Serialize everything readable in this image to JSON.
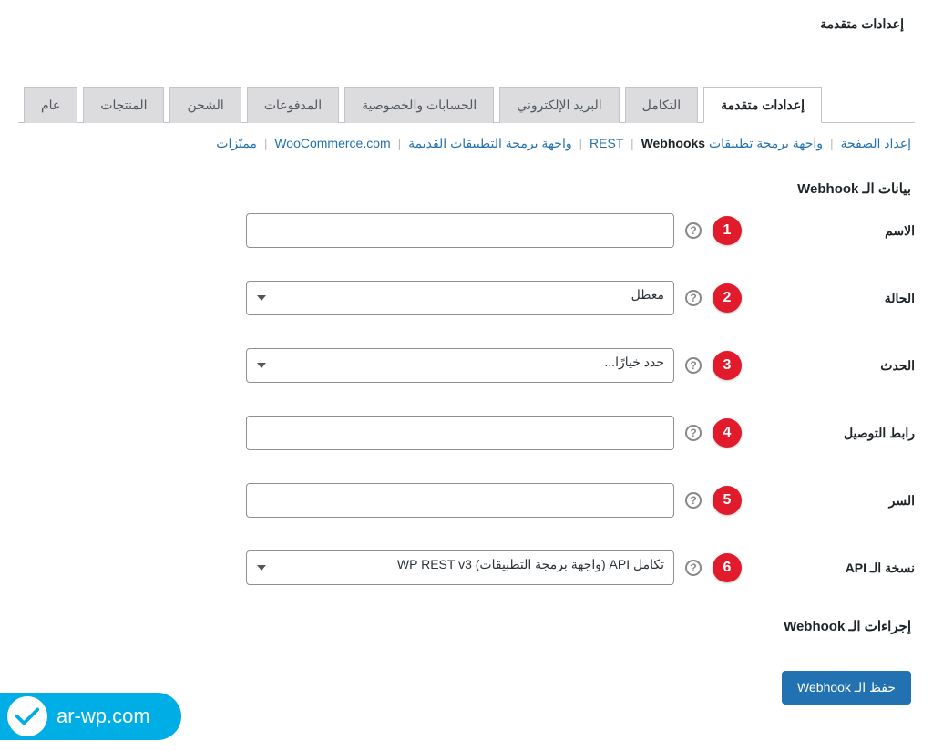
{
  "page_title": "إعدادات متقدمة",
  "tabs": {
    "general": "عام",
    "products": "المنتجات",
    "shipping": "الشحن",
    "payments": "المدفوعات",
    "accounts": "الحسابات والخصوصية",
    "emails": "البريد الإلكتروني",
    "integration": "التكامل",
    "advanced": "إعدادات متقدمة"
  },
  "subnav": {
    "page_setup": "إعداد الصفحة",
    "rest_api": "واجهة برمجة تطبيقات REST",
    "webhooks": "Webhooks",
    "legacy_api": "واجهة برمجة التطبيقات القديمة",
    "wccom": "WooCommerce.com",
    "features": "مميّزات"
  },
  "section_webhook_data": "بيانات الـ Webhook",
  "section_webhook_actions": "إجراءات الـ Webhook",
  "fields": {
    "name": {
      "label": "الاسم",
      "value": "",
      "annot": "1"
    },
    "status": {
      "label": "الحالة",
      "value": "معطل",
      "annot": "2"
    },
    "topic": {
      "label": "الحدث",
      "value": "حدد خيارًا...",
      "annot": "3"
    },
    "delivery_url": {
      "label": "رابط التوصيل",
      "value": "",
      "annot": "4"
    },
    "secret": {
      "label": "السر",
      "value": "",
      "annot": "5"
    },
    "api_version": {
      "label": "نسخة الـ API",
      "value": "تكامل API (واجهة برمجة التطبيقات) WP REST v3",
      "annot": "6"
    }
  },
  "save_button": "حفظ الـ Webhook",
  "help_glyph": "?",
  "logo_text": "ar-wp.com"
}
